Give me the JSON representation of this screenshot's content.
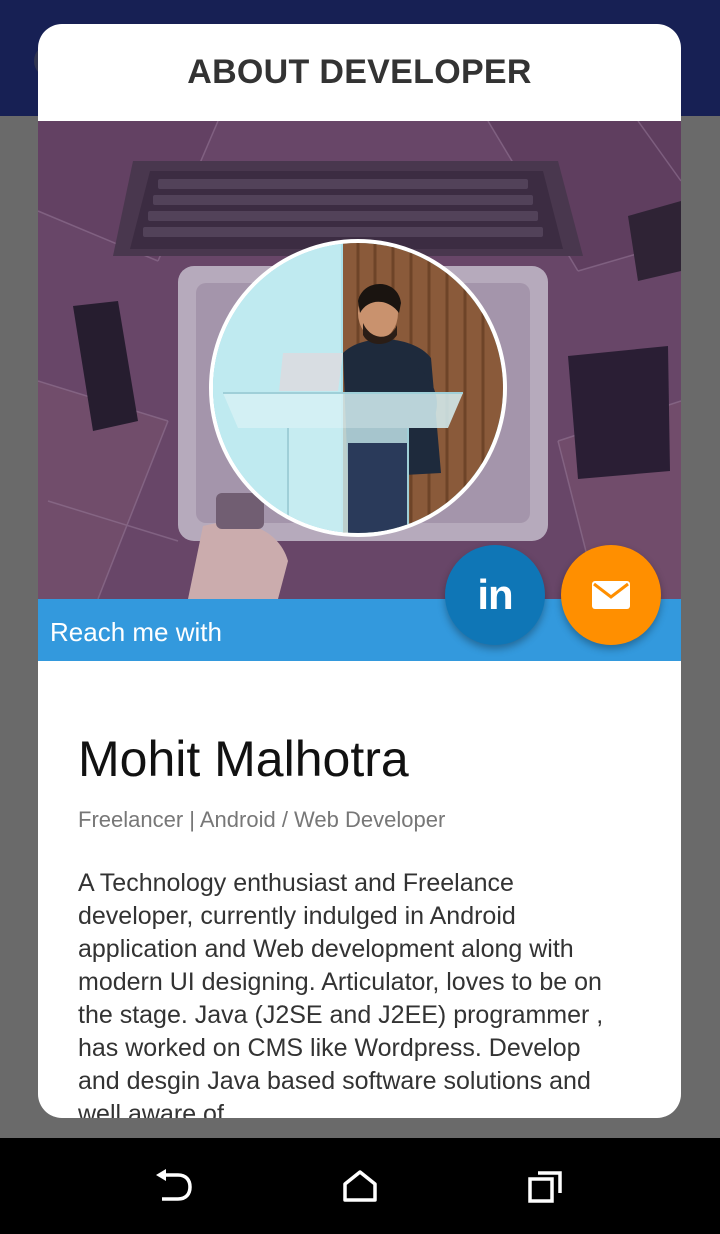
{
  "dialog": {
    "title": "ABOUT DEVELOPER"
  },
  "reach": {
    "label": "Reach me with",
    "linkedin_label": "in"
  },
  "developer": {
    "name": "Mohit Malhotra",
    "role": "Freelancer | Android / Web Developer",
    "bio": "A Technology enthusiast and Freelance developer, currently indulged in Android application and Web development along with modern UI designing. Articulator, loves to be on the stage. Java (J2SE and J2EE) programmer , has worked on CMS like Wordpress. Develop and desgin Java based software solutions and well aware of"
  },
  "colors": {
    "app_bar": "#1c2663",
    "reach_bar": "#3399dd",
    "linkedin": "#0f76b6",
    "email": "#ff8f00"
  },
  "icons": {
    "linkedin": "linkedin-icon",
    "email": "envelope-icon",
    "back": "back-arrow-icon",
    "home": "home-icon",
    "recents": "recents-icon"
  }
}
